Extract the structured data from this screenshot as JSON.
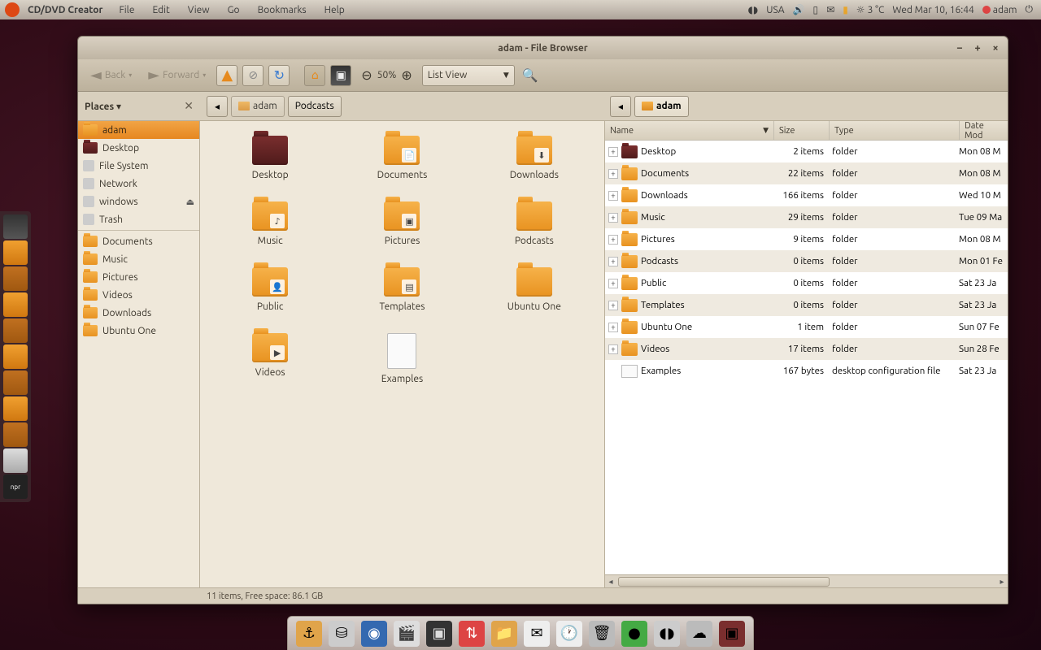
{
  "panel": {
    "app_name": "CD/DVD Creator",
    "menus": [
      "File",
      "Edit",
      "View",
      "Go",
      "Bookmarks",
      "Help"
    ],
    "keyboard": "USA",
    "weather": "3 °C",
    "datetime": "Wed Mar 10, 16:44",
    "user": "adam"
  },
  "window": {
    "title": "adam - File Browser",
    "back": "Back",
    "forward": "Forward",
    "zoom": "50%",
    "view_mode": "List View",
    "places_label": "Places ▾",
    "breadcrumb_left": [
      "adam",
      "Podcasts"
    ],
    "breadcrumb_right": [
      "adam"
    ],
    "statusbar": "11 items, Free space: 86.1 GB"
  },
  "sidebar": {
    "primary": [
      {
        "label": "adam",
        "icon": "home"
      },
      {
        "label": "Desktop",
        "icon": "desktop"
      },
      {
        "label": "File System",
        "icon": "drive"
      },
      {
        "label": "Network",
        "icon": "network"
      },
      {
        "label": "windows",
        "icon": "drive",
        "ejectable": true
      },
      {
        "label": "Trash",
        "icon": "trash"
      }
    ],
    "bookmarks": [
      {
        "label": "Documents"
      },
      {
        "label": "Music"
      },
      {
        "label": "Pictures"
      },
      {
        "label": "Videos"
      },
      {
        "label": "Downloads"
      },
      {
        "label": "Ubuntu One"
      }
    ]
  },
  "icons": [
    {
      "label": "Desktop",
      "kind": "desktop"
    },
    {
      "label": "Documents",
      "kind": "folder",
      "overlay": "doc"
    },
    {
      "label": "Downloads",
      "kind": "folder",
      "overlay": "down"
    },
    {
      "label": "Music",
      "kind": "folder",
      "overlay": "music"
    },
    {
      "label": "Pictures",
      "kind": "folder",
      "overlay": "pic"
    },
    {
      "label": "Podcasts",
      "kind": "folder"
    },
    {
      "label": "Public",
      "kind": "folder",
      "overlay": "pub"
    },
    {
      "label": "Templates",
      "kind": "folder",
      "overlay": "tpl"
    },
    {
      "label": "Ubuntu One",
      "kind": "folder"
    },
    {
      "label": "Videos",
      "kind": "folder",
      "overlay": "vid"
    },
    {
      "label": "Examples",
      "kind": "file"
    }
  ],
  "list": {
    "headers": {
      "name": "Name",
      "size": "Size",
      "type": "Type",
      "date": "Date Mod"
    },
    "rows": [
      {
        "name": "Desktop",
        "size": "2 items",
        "type": "folder",
        "date": "Mon 08 M",
        "icon": "desktop",
        "expandable": true
      },
      {
        "name": "Documents",
        "size": "22 items",
        "type": "folder",
        "date": "Mon 08 M",
        "icon": "folder",
        "expandable": true
      },
      {
        "name": "Downloads",
        "size": "166 items",
        "type": "folder",
        "date": "Wed 10 M",
        "icon": "folder",
        "expandable": true
      },
      {
        "name": "Music",
        "size": "29 items",
        "type": "folder",
        "date": "Tue 09 Ma",
        "icon": "folder",
        "expandable": true
      },
      {
        "name": "Pictures",
        "size": "9 items",
        "type": "folder",
        "date": "Mon 08 M",
        "icon": "folder",
        "expandable": true
      },
      {
        "name": "Podcasts",
        "size": "0 items",
        "type": "folder",
        "date": "Mon 01 Fe",
        "icon": "folder",
        "expandable": true
      },
      {
        "name": "Public",
        "size": "0 items",
        "type": "folder",
        "date": "Sat 23 Ja",
        "icon": "folder",
        "expandable": true
      },
      {
        "name": "Templates",
        "size": "0 items",
        "type": "folder",
        "date": "Sat 23 Ja",
        "icon": "folder",
        "expandable": true
      },
      {
        "name": "Ubuntu One",
        "size": "1 item",
        "type": "folder",
        "date": "Sun 07 Fe",
        "icon": "folder",
        "expandable": true
      },
      {
        "name": "Videos",
        "size": "17 items",
        "type": "folder",
        "date": "Sun 28 Fe",
        "icon": "folder",
        "expandable": true
      },
      {
        "name": "Examples",
        "size": "167 bytes",
        "type": "desktop configuration file",
        "date": "Sat 23 Ja",
        "icon": "file",
        "expandable": false
      }
    ]
  },
  "launcher_items": [
    "screen",
    "home",
    "folder",
    "folder",
    "folder",
    "folder",
    "folder",
    "folder",
    "folder",
    "disk",
    "npr"
  ],
  "dock_items": [
    "anchor",
    "drive",
    "globe",
    "clapper",
    "terminal",
    "transmission",
    "files",
    "mail",
    "clock",
    "trash",
    "green",
    "wifi",
    "weather",
    "window"
  ]
}
